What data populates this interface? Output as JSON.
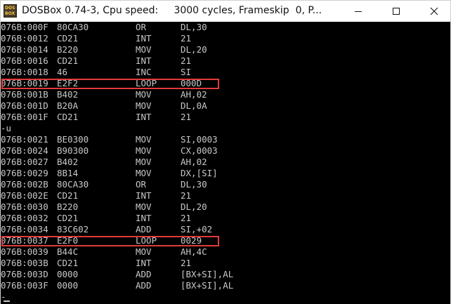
{
  "window": {
    "title": "DOSBox 0.74-3, Cpu speed:     3000 cycles, Frameskip  0, P...",
    "icon_text_top": "DOS",
    "icon_text_bottom": "BOX"
  },
  "terminal": {
    "lines": [
      {
        "addr": "076B:000F",
        "bytes": "80CA30",
        "mnemonic": "OR",
        "operands": "DL,30"
      },
      {
        "addr": "076B:0012",
        "bytes": "CD21",
        "mnemonic": "INT",
        "operands": "21"
      },
      {
        "addr": "076B:0014",
        "bytes": "B220",
        "mnemonic": "MOV",
        "operands": "DL,20"
      },
      {
        "addr": "076B:0016",
        "bytes": "CD21",
        "mnemonic": "INT",
        "operands": "21"
      },
      {
        "addr": "076B:0018",
        "bytes": "46",
        "mnemonic": "INC",
        "operands": "SI"
      },
      {
        "addr": "076B:0019",
        "bytes": "E2F2",
        "mnemonic": "LOOP",
        "operands": "000D",
        "highlighted": true
      },
      {
        "addr": "076B:001B",
        "bytes": "B402",
        "mnemonic": "MOV",
        "operands": "AH,02"
      },
      {
        "addr": "076B:001D",
        "bytes": "B20A",
        "mnemonic": "MOV",
        "operands": "DL,0A"
      },
      {
        "addr": "076B:001F",
        "bytes": "CD21",
        "mnemonic": "INT",
        "operands": "21"
      },
      {
        "prompt": "-u"
      },
      {
        "addr": "076B:0021",
        "bytes": "BE0300",
        "mnemonic": "MOV",
        "operands": "SI,0003"
      },
      {
        "addr": "076B:0024",
        "bytes": "B90300",
        "mnemonic": "MOV",
        "operands": "CX,0003"
      },
      {
        "addr": "076B:0027",
        "bytes": "B402",
        "mnemonic": "MOV",
        "operands": "AH,02"
      },
      {
        "addr": "076B:0029",
        "bytes": "8B14",
        "mnemonic": "MOV",
        "operands": "DX,[SI]"
      },
      {
        "addr": "076B:002B",
        "bytes": "80CA30",
        "mnemonic": "OR",
        "operands": "DL,30"
      },
      {
        "addr": "076B:002E",
        "bytes": "CD21",
        "mnemonic": "INT",
        "operands": "21"
      },
      {
        "addr": "076B:0030",
        "bytes": "B220",
        "mnemonic": "MOV",
        "operands": "DL,20"
      },
      {
        "addr": "076B:0032",
        "bytes": "CD21",
        "mnemonic": "INT",
        "operands": "21"
      },
      {
        "addr": "076B:0034",
        "bytes": "83C602",
        "mnemonic": "ADD",
        "operands": "SI,+02"
      },
      {
        "addr": "076B:0037",
        "bytes": "E2F0",
        "mnemonic": "LOOP",
        "operands": "0029",
        "highlighted": true
      },
      {
        "addr": "076B:0039",
        "bytes": "B44C",
        "mnemonic": "MOV",
        "operands": "AH,4C"
      },
      {
        "addr": "076B:003B",
        "bytes": "CD21",
        "mnemonic": "INT",
        "operands": "21"
      },
      {
        "addr": "076B:003D",
        "bytes": "0000",
        "mnemonic": "ADD",
        "operands": "[BX+SI],AL"
      },
      {
        "addr": "076B:003F",
        "bytes": "0000",
        "mnemonic": "ADD",
        "operands": "[BX+SI],AL"
      },
      {
        "prompt": "-"
      }
    ]
  },
  "colors": {
    "terminal_bg": "#000000",
    "terminal_text": "#c8c8c8",
    "highlight_border": "#e23a3a"
  },
  "icons": {
    "app": "dosbox-icon",
    "minimize": "minimize-icon",
    "maximize": "maximize-icon",
    "close": "close-icon"
  }
}
